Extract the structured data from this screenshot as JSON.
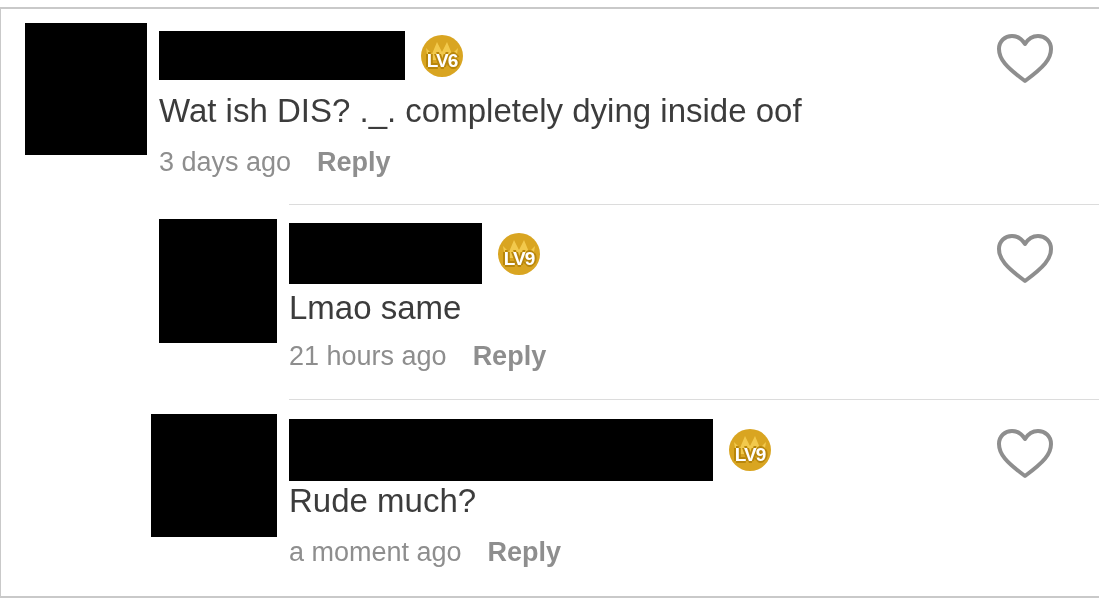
{
  "comments": [
    {
      "level": "LV6",
      "text": "Wat ish DIS? ._. completely dying inside oof",
      "time": "3 days ago",
      "reply": "Reply",
      "liked": false,
      "children": [
        {
          "level": "LV9",
          "text": "Lmao same",
          "time": "21 hours ago",
          "reply": "Reply",
          "liked": false
        },
        {
          "level": "LV9",
          "text": "Rude much?",
          "time": "a moment ago",
          "reply": "Reply",
          "liked": false
        }
      ]
    }
  ]
}
